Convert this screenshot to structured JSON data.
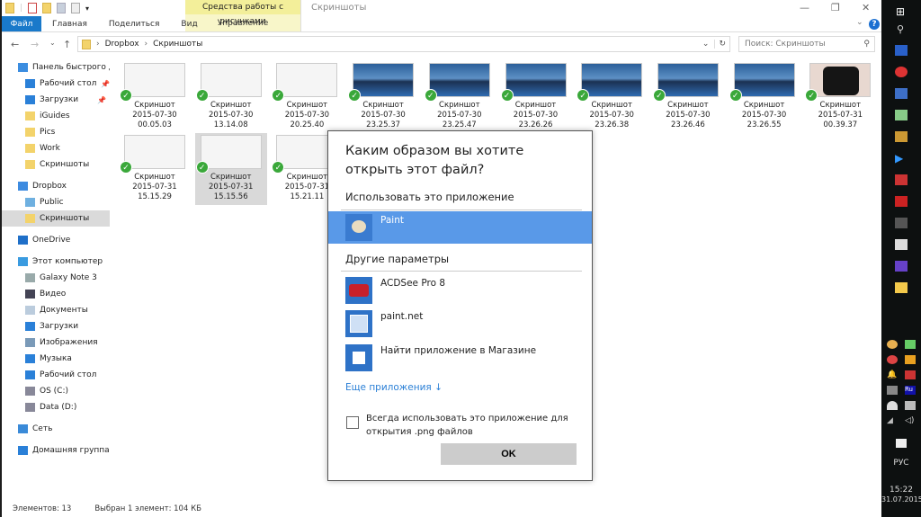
{
  "ribbon": {
    "tabs": [
      "Файл",
      "Главная",
      "Поделиться",
      "Вид"
    ],
    "context_group": "Средства работы с рисунками",
    "context_tab": "Управление",
    "window_title": "Скриншоты"
  },
  "address": {
    "crumbs": [
      "Dropbox",
      "Скриншоты"
    ],
    "search_placeholder": "Поиск: Скриншоты"
  },
  "sidebar": [
    {
      "label": "Панель быстрого доступа",
      "icon": "star-icon",
      "level": 0,
      "color": "#3b8de0"
    },
    {
      "label": "Рабочий стол",
      "icon": "desktop-icon",
      "level": 1,
      "pinned": true,
      "color": "#2a80d8"
    },
    {
      "label": "Загрузки",
      "icon": "download-icon",
      "level": 1,
      "pinned": true,
      "color": "#2a80d8"
    },
    {
      "label": "iGuides",
      "icon": "folder-icon",
      "level": 1,
      "color": "#f3d36b"
    },
    {
      "label": "Pics",
      "icon": "folder-icon",
      "level": 1,
      "color": "#f3d36b"
    },
    {
      "label": "Work",
      "icon": "folder-icon",
      "level": 1,
      "color": "#f3d36b"
    },
    {
      "label": "Скриншоты",
      "icon": "folder-synced-icon",
      "level": 1,
      "color": "#f3d36b"
    },
    {
      "label": "Dropbox",
      "icon": "dropbox-icon",
      "level": 0,
      "color": "#3d8be0",
      "gap": true
    },
    {
      "label": "Public",
      "icon": "globe-icon",
      "level": 1,
      "color": "#6fb0e0"
    },
    {
      "label": "Скриншоты",
      "icon": "folder-synced-icon",
      "level": 1,
      "selected": true,
      "color": "#f3d36b"
    },
    {
      "label": "OneDrive",
      "icon": "onedrive-icon",
      "level": 0,
      "color": "#1f6fc8",
      "gap": true
    },
    {
      "label": "Этот компьютер",
      "icon": "computer-icon",
      "level": 0,
      "color": "#3a9be0",
      "gap": true
    },
    {
      "label": "Galaxy Note 3",
      "icon": "phone-icon",
      "level": 1,
      "color": "#9aa"
    },
    {
      "label": "Видео",
      "icon": "video-icon",
      "level": 1,
      "color": "#445"
    },
    {
      "label": "Документы",
      "icon": "documents-icon",
      "level": 1,
      "color": "#bcd"
    },
    {
      "label": "Загрузки",
      "icon": "download-icon",
      "level": 1,
      "color": "#2a80d8"
    },
    {
      "label": "Изображения",
      "icon": "pictures-icon",
      "level": 1,
      "color": "#7a9ab8"
    },
    {
      "label": "Музыка",
      "icon": "music-icon",
      "level": 1,
      "color": "#2a80d8"
    },
    {
      "label": "Рабочий стол",
      "icon": "desktop-icon",
      "level": 1,
      "color": "#2a80d8"
    },
    {
      "label": "OS (C:)",
      "icon": "drive-icon",
      "level": 1,
      "color": "#889"
    },
    {
      "label": "Data (D:)",
      "icon": "drive-icon",
      "level": 1,
      "color": "#889"
    },
    {
      "label": "Сеть",
      "icon": "network-icon",
      "level": 0,
      "color": "#3a8ad8",
      "gap": true
    },
    {
      "label": "Домашняя группа",
      "icon": "homegroup-icon",
      "level": 0,
      "color": "#2a80d8",
      "gap": true
    }
  ],
  "files": [
    {
      "name": "Скриншот",
      "date": "2015-07-30",
      "time": "00.05.03",
      "thumb": "white"
    },
    {
      "name": "Скриншот",
      "date": "2015-07-30",
      "time": "13.14.08",
      "thumb": "white"
    },
    {
      "name": "Скриншот",
      "date": "2015-07-30",
      "time": "20.25.40",
      "thumb": "white"
    },
    {
      "name": "Скриншот",
      "date": "2015-07-30",
      "time": "23.25.37",
      "thumb": "blue"
    },
    {
      "name": "Скриншот",
      "date": "2015-07-30",
      "time": "23.25.47",
      "thumb": "blue"
    },
    {
      "name": "Скриншот",
      "date": "2015-07-30",
      "time": "23.26.26",
      "thumb": "blue"
    },
    {
      "name": "Скриншот",
      "date": "2015-07-30",
      "time": "23.26.38",
      "thumb": "blue"
    },
    {
      "name": "Скриншот",
      "date": "2015-07-30",
      "time": "23.26.46",
      "thumb": "blue"
    },
    {
      "name": "Скриншот",
      "date": "2015-07-30",
      "time": "23.26.55",
      "thumb": "blue"
    },
    {
      "name": "Скриншот",
      "date": "2015-07-31",
      "time": "00.39.37",
      "thumb": "apple"
    },
    {
      "name": "Скриншот",
      "date": "2015-07-31",
      "time": "15.15.29",
      "thumb": "white"
    },
    {
      "name": "Скриншот",
      "date": "2015-07-31",
      "time": "15.15.56",
      "thumb": "white",
      "selected": true
    },
    {
      "name": "Скриншот",
      "date": "2015-07-31",
      "time": "15.21.11",
      "thumb": "white"
    }
  ],
  "status": {
    "count": "Элементов: 13",
    "selection": "Выбран 1 элемент: 104 КБ"
  },
  "dialog": {
    "title": "Каким образом вы хотите открыть этот файл?",
    "use_this": "Использовать это приложение",
    "recommended": {
      "name": "Paint",
      "icon": "paint-icon"
    },
    "other_header": "Другие параметры",
    "others": [
      {
        "name": "ACDSee Pro 8",
        "icon": "acdsee-icon"
      },
      {
        "name": "paint.net",
        "icon": "paintnet-icon"
      },
      {
        "name": "Найти приложение в Магазине",
        "icon": "store-icon"
      }
    ],
    "more_apps": "Еще приложения ↓",
    "always_use": "Всегда использовать это приложение для открытия .png файлов",
    "always_checked": false,
    "ok": "OK",
    "highlight_color": "#5999e8"
  },
  "taskbar": {
    "language": "РУС",
    "time": "15:22",
    "date": "31.07.2015"
  }
}
